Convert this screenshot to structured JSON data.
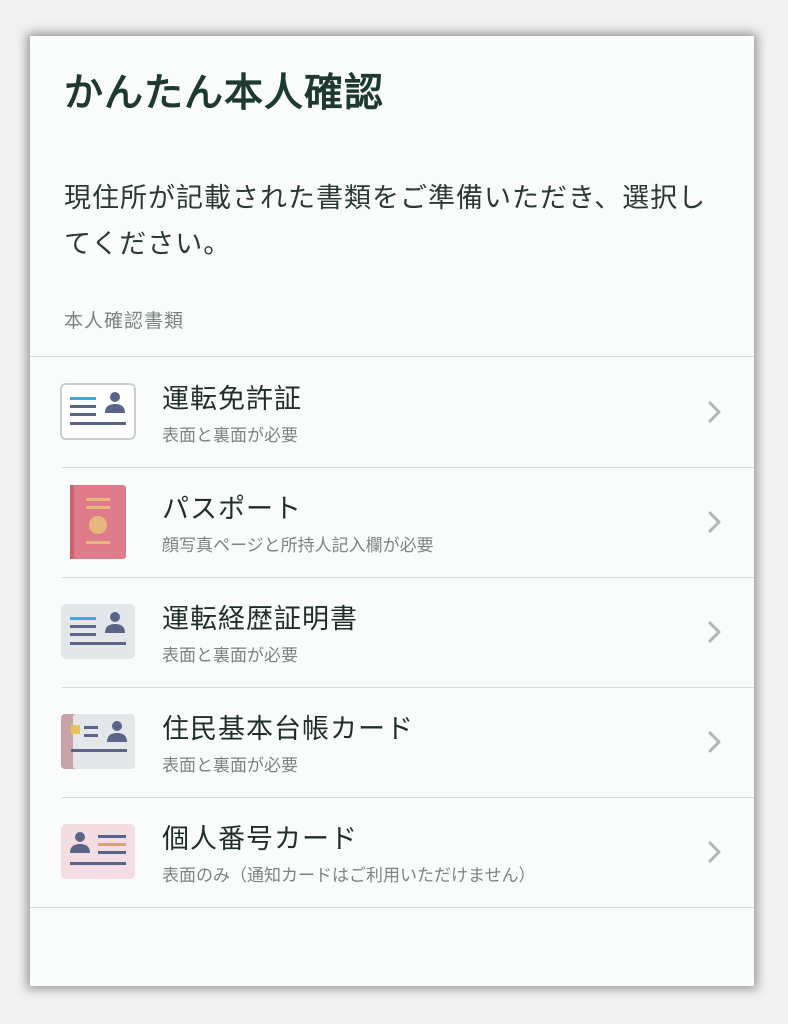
{
  "header": {
    "title": "かんたん本人確認"
  },
  "instruction": "現住所が記載された書類をご準備いただき、選択してください。",
  "section_label": "本人確認書類",
  "documents": [
    {
      "name": "運転免許証",
      "description": "表面と裏面が必要",
      "icon": "drivers-license-icon"
    },
    {
      "name": "パスポート",
      "description": "顔写真ページと所持人記入欄が必要",
      "icon": "passport-icon"
    },
    {
      "name": "運転経歴証明書",
      "description": "表面と裏面が必要",
      "icon": "driving-history-certificate-icon"
    },
    {
      "name": "住民基本台帳カード",
      "description": "表面と裏面が必要",
      "icon": "resident-registry-card-icon"
    },
    {
      "name": "個人番号カード",
      "description": "表面のみ（通知カードはご利用いただけません）",
      "icon": "my-number-card-icon"
    }
  ],
  "colors": {
    "title": "#1e3a2e",
    "divider": "#d6dbd8",
    "subtext": "#7a8580",
    "passport": "#e07c8a",
    "accent_blue": "#3ea7e0",
    "card_navy": "#5a6488"
  }
}
